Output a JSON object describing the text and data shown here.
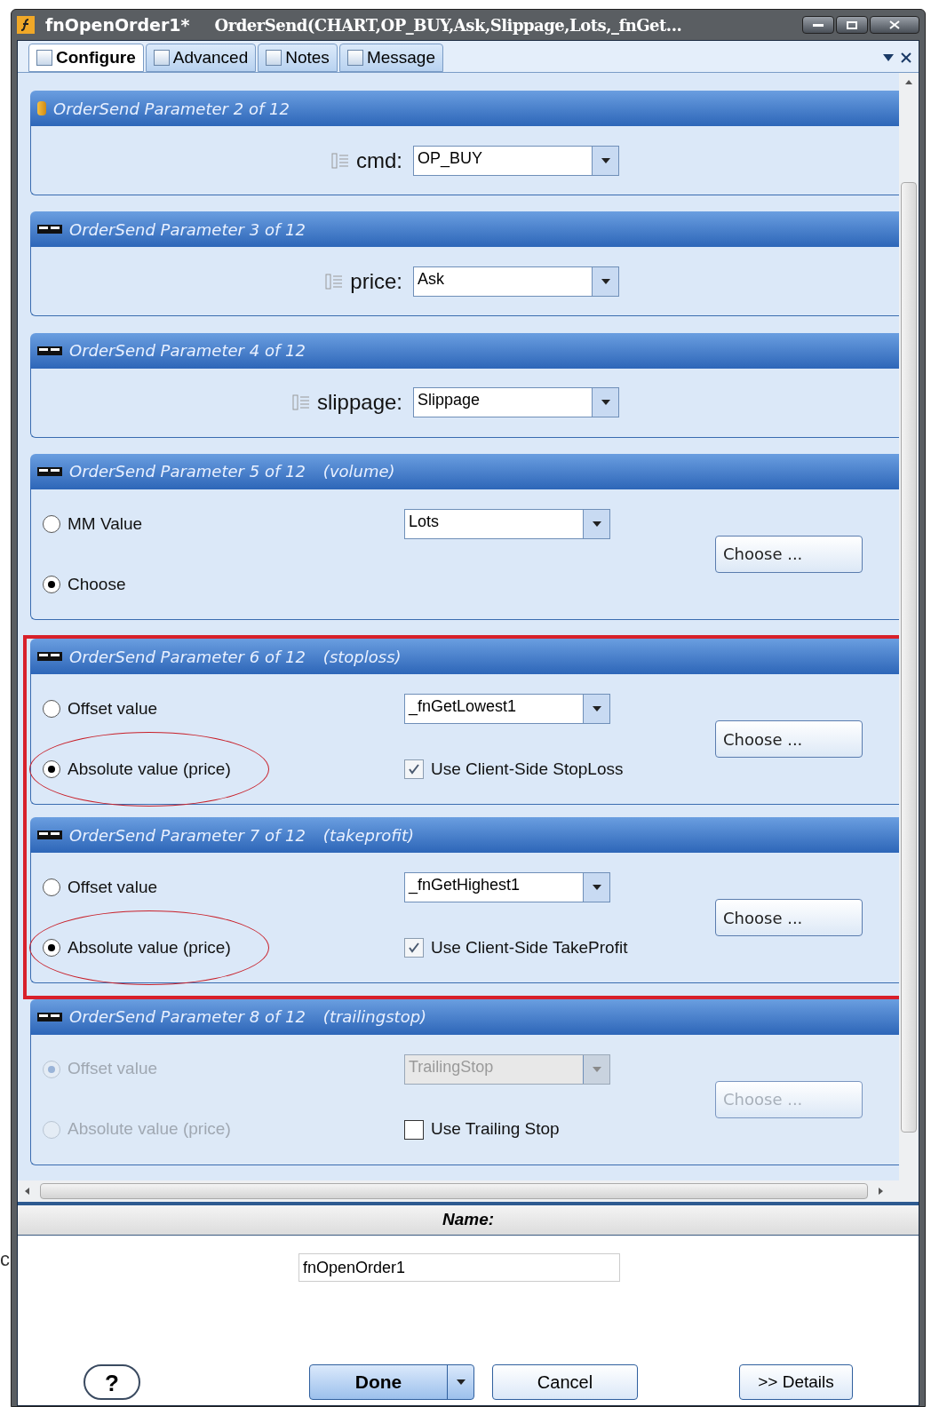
{
  "background_text": "c",
  "window": {
    "title": "fnOpenOrder1*",
    "subtitle": "OrderSend(CHART,OP_BUY,Ask,Slippage,Lots,_fnGet..."
  },
  "tabs": [
    {
      "label": "Configure",
      "selected": true
    },
    {
      "label": "Advanced",
      "selected": false
    },
    {
      "label": "Notes",
      "selected": false
    },
    {
      "label": "Message",
      "selected": false
    }
  ],
  "sections": [
    {
      "kind": "param",
      "title": "OrderSend Parameter 2 of 12",
      "label": "cmd:",
      "value": "OP_BUY",
      "highlighted": false,
      "disabled": false
    },
    {
      "kind": "param",
      "title": "OrderSend Parameter 3 of 12",
      "label": "price:",
      "value": "Ask",
      "highlighted": false,
      "disabled": false
    },
    {
      "kind": "param",
      "title": "OrderSend Parameter 4 of 12",
      "label": "slippage:",
      "value": "Slippage",
      "highlighted": false,
      "disabled": false
    },
    {
      "kind": "options",
      "title": "OrderSend Parameter 5 of 12",
      "note": "(volume)",
      "highlighted": false,
      "disabled": false,
      "options": [
        {
          "label": "MM Value",
          "selected": false,
          "circled": false
        },
        {
          "label": "Choose",
          "selected": true,
          "circled": false
        }
      ],
      "value": "Lots",
      "button": "Choose ..."
    },
    {
      "kind": "options",
      "title": "OrderSend Parameter 6 of 12",
      "note": "(stoploss)",
      "highlighted": true,
      "disabled": false,
      "options": [
        {
          "label": "Offset value",
          "selected": false,
          "circled": false
        },
        {
          "label": "Absolute value (price)",
          "selected": true,
          "circled": true
        }
      ],
      "value": "_fnGetLowest1",
      "button": "Choose ...",
      "checkbox": {
        "label": "Use Client-Side StopLoss",
        "checked": true
      }
    },
    {
      "kind": "options",
      "title": "OrderSend Parameter 7 of 12",
      "note": "(takeprofit)",
      "highlighted": true,
      "disabled": false,
      "options": [
        {
          "label": "Offset value",
          "selected": false,
          "circled": false
        },
        {
          "label": "Absolute value (price)",
          "selected": true,
          "circled": true
        }
      ],
      "value": "_fnGetHighest1",
      "button": "Choose ...",
      "checkbox": {
        "label": "Use Client-Side TakeProfit",
        "checked": true
      }
    },
    {
      "kind": "options",
      "title": "OrderSend Parameter 8 of 12",
      "note": "(trailingstop)",
      "highlighted": false,
      "disabled": true,
      "options": [
        {
          "label": "Offset value",
          "selected": true,
          "circled": false
        },
        {
          "label": "Absolute value (price)",
          "selected": false,
          "circled": false
        }
      ],
      "value": "TrailingStop",
      "button": "Choose ...",
      "checkbox": {
        "label": "Use Trailing Stop",
        "checked": false
      }
    }
  ],
  "name_panel": {
    "heading": "Name:",
    "value": "fnOpenOrder1"
  },
  "buttons": [
    {
      "kind": "help",
      "label": "?"
    },
    {
      "kind": "split",
      "label": "Done"
    },
    {
      "kind": "plain",
      "label": "Cancel"
    },
    {
      "kind": "details",
      "label": ">> Details"
    }
  ]
}
